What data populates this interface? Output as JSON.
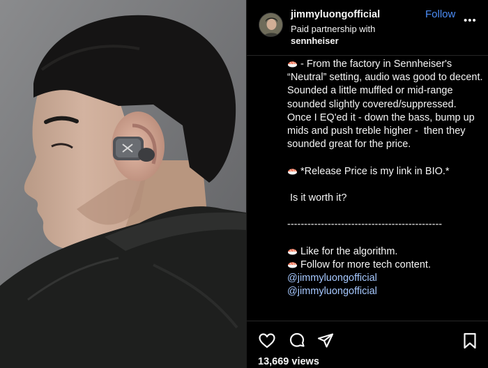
{
  "post": {
    "photo_alt": "",
    "header": {
      "username": "jimmyluongofficial",
      "partnership_label": "Paid partnership with",
      "partner_name": "sennheiser",
      "follow_label": "Follow",
      "more_label": "•••",
      "avatar_icon": "user-avatar"
    },
    "caption": {
      "line1": "- From the factory in Sennheiser's “Neutral” setting, audio was good to decent.  Sounded a little muffled or mid-range sounded slightly covered/suppressed.  Once I EQ'ed it - down the bass, bump up mids and push treble higher -  then they sounded great for the price.",
      "line2": "*Release Price is my link in BIO.*",
      "line3": " Is it worth it?",
      "divider": "----------------------------------------------",
      "line4": "Like for the algorithm.",
      "line5": "Follow for more tech content.",
      "mention1": "@jimmyluongofficial",
      "mention2": "@jimmyluongofficial",
      "emoji_icon": "sushi-emoji"
    },
    "actions": {
      "like_icon": "heart-icon",
      "comment_icon": "comment-icon",
      "share_icon": "send-icon",
      "save_icon": "bookmark-icon"
    },
    "views": "13,669 views"
  },
  "colors": {
    "background": "#000000",
    "text": "#f5f5f5",
    "follow_accent": "#4c8df6",
    "mention_link": "#a6c8ff",
    "photo_backdrop": "#7c7d7f"
  }
}
